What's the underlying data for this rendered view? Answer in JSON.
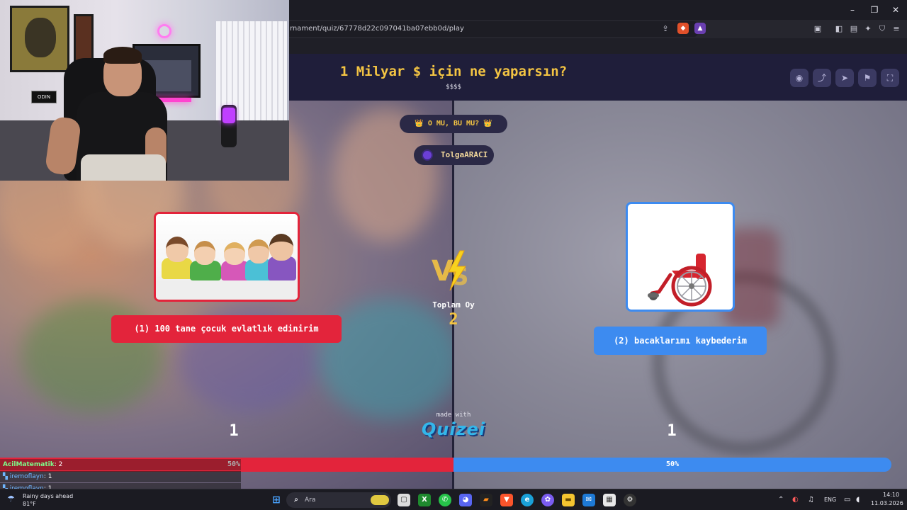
{
  "browser": {
    "url": "rnament/quiz/67778d22c097041ba07ebb0d/play",
    "window_controls": [
      "–",
      "❐",
      "✕"
    ]
  },
  "quiz": {
    "title": "1 Milyar $ için ne yaparsın?",
    "subtitle": "$$$$",
    "mode_label": "👑 O MU, BU MU? 👑",
    "author": "TolgaARACI",
    "left_option": {
      "label": "(1) 100 tane çocuk evlatlık edinirim",
      "votes": "1",
      "percent": "50%",
      "color": "#e3243b"
    },
    "right_option": {
      "label": "(2) bacaklarımı kaybederim",
      "votes": "1",
      "percent": "50%",
      "color": "#3d8bf0"
    },
    "total_label": "Toplam Oy",
    "total_value": "2",
    "made_with": "made with",
    "brand": "Quizei",
    "header_icons": [
      "eye-icon",
      "share-icon",
      "send-icon",
      "flag-icon",
      "fullscreen-icon"
    ]
  },
  "chat": [
    {
      "user": "AcilMatematik",
      "text": ": 2"
    },
    {
      "user": "iremoflayn",
      "text": ": 1"
    },
    {
      "user": "iremoflayn",
      "text": ": 1"
    }
  ],
  "webcam": {
    "sign": "ODIN"
  },
  "taskbar": {
    "weather_text": "Rainy days ahead",
    "weather_temp": "81°F",
    "search_placeholder": "Ara",
    "lang": "ENG",
    "time": "14:10",
    "date": "11.03.2026"
  }
}
